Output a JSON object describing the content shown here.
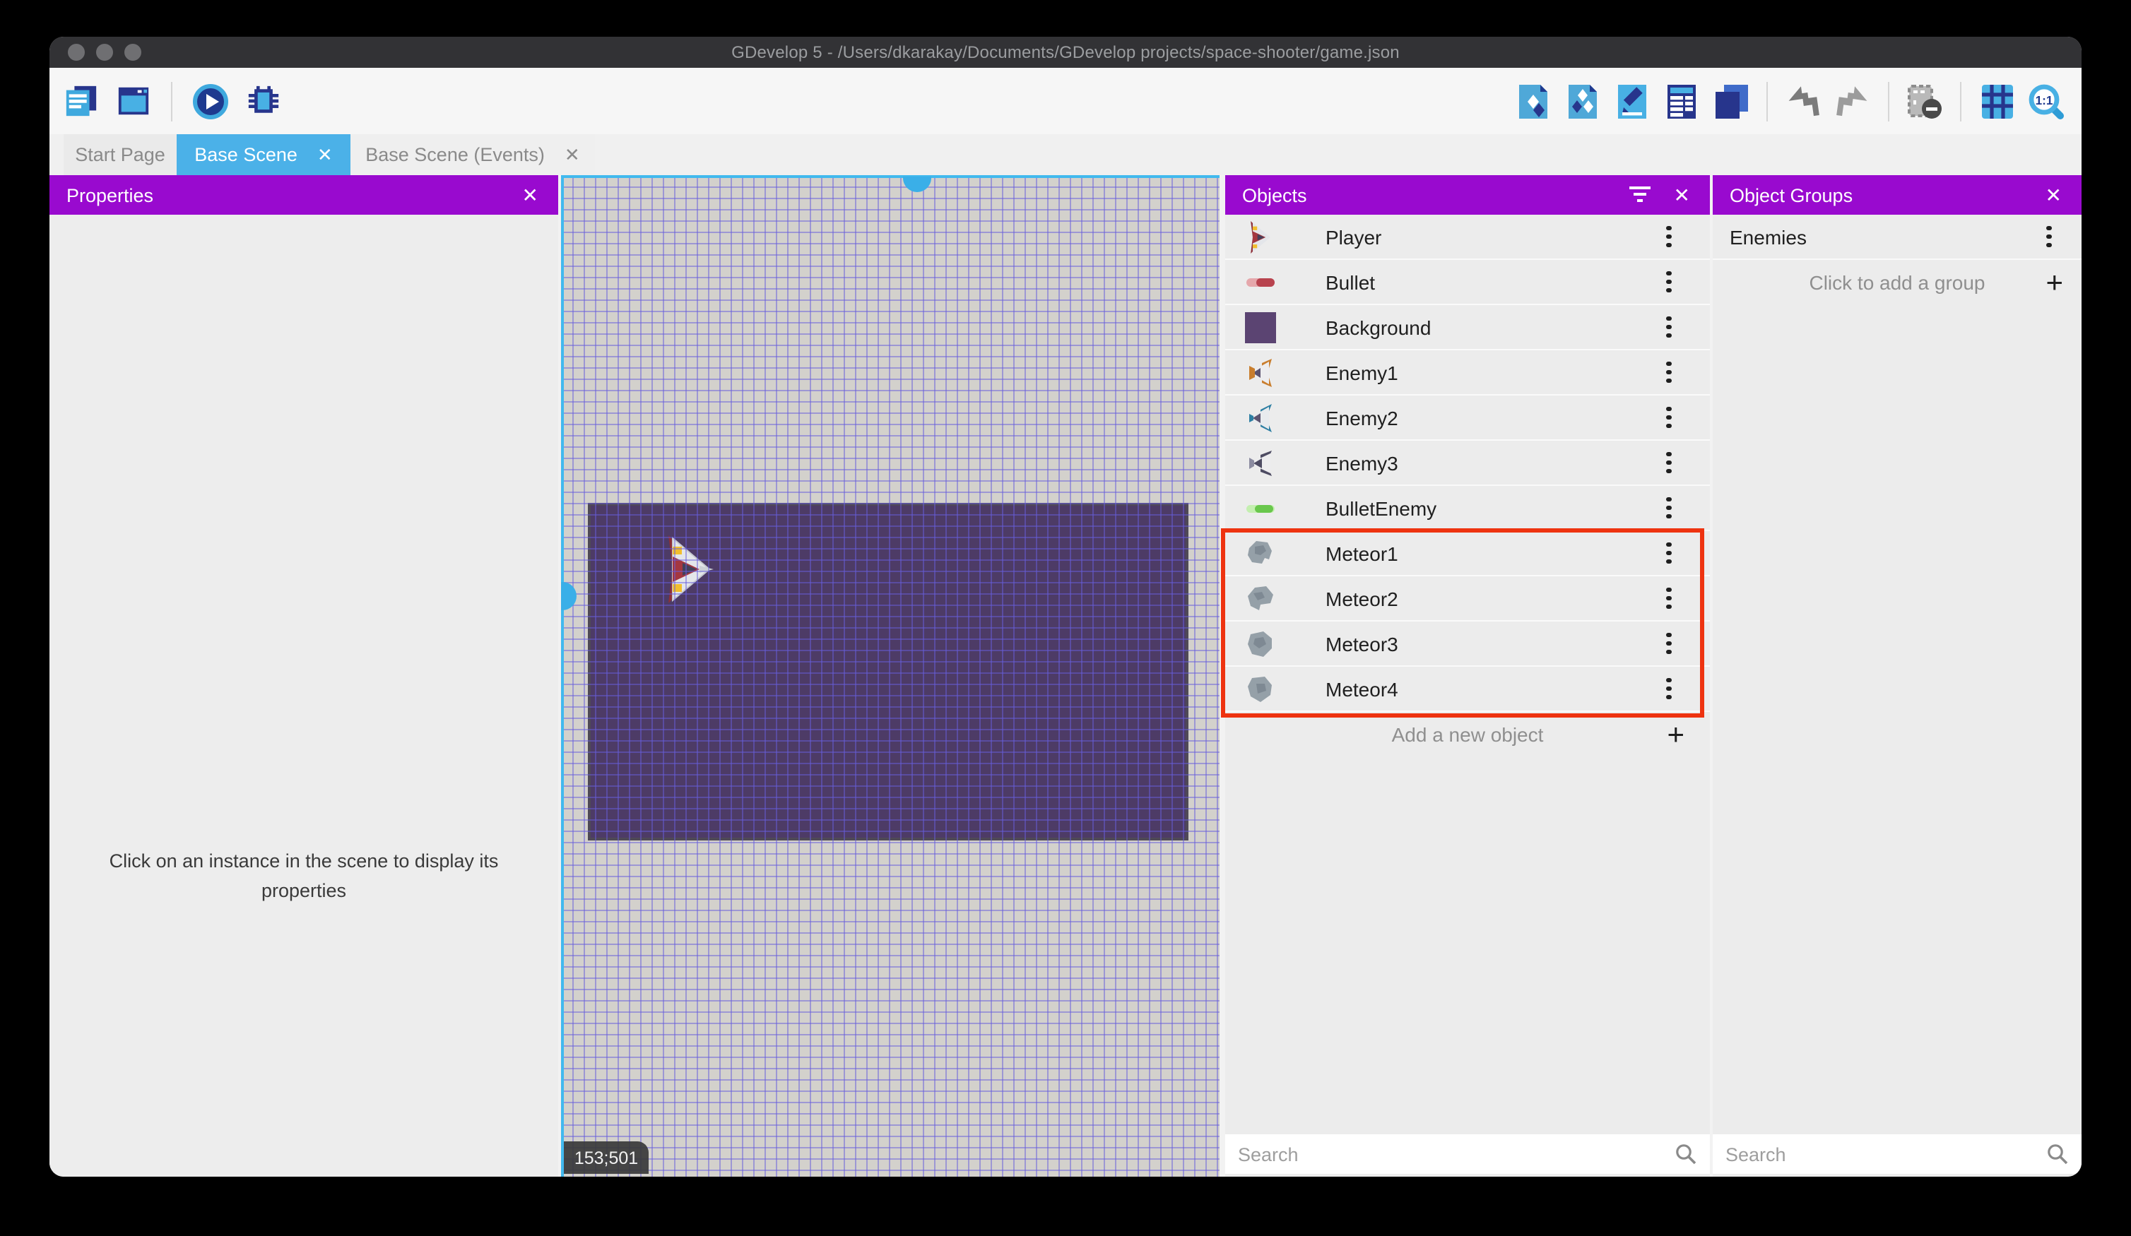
{
  "window": {
    "title": "GDevelop 5 - /Users/dkarakay/Documents/GDevelop projects/space-shooter/game.json"
  },
  "toolbar": {
    "left_icons": [
      "project-manager-icon",
      "scene-window-icon",
      "play-icon",
      "debug-icon"
    ],
    "right_icons": [
      "objects-editor-icon",
      "object-groups-icon",
      "properties-icon",
      "instances-list-icon",
      "layers-icon",
      "undo-icon",
      "redo-icon",
      "mask-icon",
      "grid-icon",
      "zoom-1-1-icon"
    ]
  },
  "tabs": [
    {
      "label": "Start Page",
      "active": false,
      "closable": false
    },
    {
      "label": "Base Scene",
      "active": true,
      "closable": true,
      "close_glyph": "✕"
    },
    {
      "label": "Base Scene (Events)",
      "active": false,
      "closable": true,
      "close_glyph": "✕"
    }
  ],
  "properties_panel": {
    "title": "Properties",
    "close_glyph": "✕",
    "empty_message": "Click on an instance in the scene to display its properties"
  },
  "scene": {
    "coordinates": "153;501",
    "selected_object": "Background"
  },
  "objects_panel": {
    "title": "Objects",
    "close_glyph": "✕",
    "items": [
      {
        "label": "Player",
        "icon": "player-ship-icon"
      },
      {
        "label": "Bullet",
        "icon": "bullet-icon"
      },
      {
        "label": "Background",
        "icon": "background-swatch-icon"
      },
      {
        "label": "Enemy1",
        "icon": "enemy1-ship-icon"
      },
      {
        "label": "Enemy2",
        "icon": "enemy2-ship-icon"
      },
      {
        "label": "Enemy3",
        "icon": "enemy3-ship-icon"
      },
      {
        "label": "BulletEnemy",
        "icon": "bullet-enemy-icon"
      },
      {
        "label": "Meteor1",
        "icon": "meteor-icon"
      },
      {
        "label": "Meteor2",
        "icon": "meteor-icon"
      },
      {
        "label": "Meteor3",
        "icon": "meteor-icon"
      },
      {
        "label": "Meteor4",
        "icon": "meteor-icon"
      }
    ],
    "highlighted_items": [
      "Meteor1",
      "Meteor2",
      "Meteor3",
      "Meteor4"
    ],
    "add_label": "Add a new object",
    "search_placeholder": "Search"
  },
  "object_groups_panel": {
    "title": "Object Groups",
    "close_glyph": "✕",
    "items": [
      {
        "label": "Enemies"
      }
    ],
    "add_label": "Click to add a group",
    "search_placeholder": "Search"
  },
  "colors": {
    "accent_purple": "#990ACF",
    "accent_cyan_tab": "#4BB1E8",
    "selection_cyan": "#41B9EE",
    "highlight_red": "#EE3310",
    "scene_background": "#4D3B66"
  }
}
